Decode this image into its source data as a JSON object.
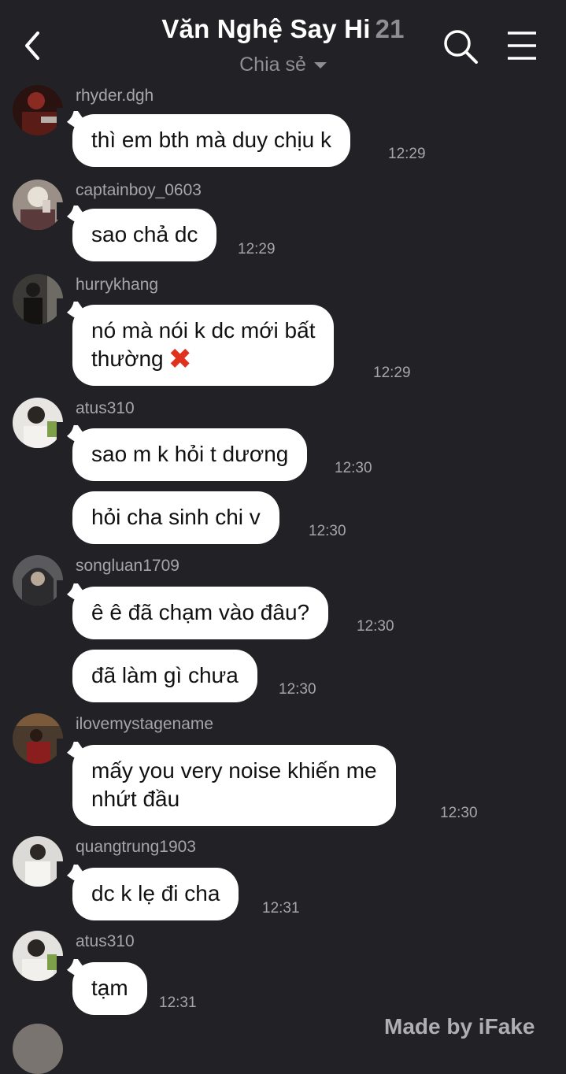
{
  "header": {
    "title": "Văn Nghệ Say Hi",
    "member_count": "21",
    "subtitle": "Chia sẻ"
  },
  "messages": [
    {
      "user": "rhyder.dgh",
      "text": "thì em bth mà duy chịu k",
      "time": "12:29"
    },
    {
      "user": "captainboy_0603",
      "text": "sao chả dc",
      "time": "12:29"
    },
    {
      "user": "hurrykhang",
      "line1": "nó mà nói k dc mới bất",
      "line2": "thường",
      "emoji": "✖",
      "time": "12:29"
    },
    {
      "user": "atus310",
      "text": "sao m k hỏi t dương",
      "time": "12:30"
    },
    {
      "text": "hỏi cha sinh chi v",
      "time": "12:30"
    },
    {
      "user": "songluan1709",
      "text": "ê ê đã chạm vào đâu?",
      "time": "12:30"
    },
    {
      "text": "đã làm gì chưa",
      "time": "12:30"
    },
    {
      "user": "ilovemystagename",
      "line1": "mấy you very noise khiến me",
      "line2": "nhứt đầu",
      "time": "12:30"
    },
    {
      "user": "quangtrung1903",
      "text": "dc k lẹ đi cha",
      "time": "12:31"
    },
    {
      "user": "atus310",
      "text": "tạm",
      "time": "12:31"
    }
  ],
  "watermark": "Made by iFake",
  "colors": {
    "background": "#222226",
    "bubble": "#ffffff",
    "muted_text": "#a5a5aa",
    "cross": "#e0301e"
  }
}
